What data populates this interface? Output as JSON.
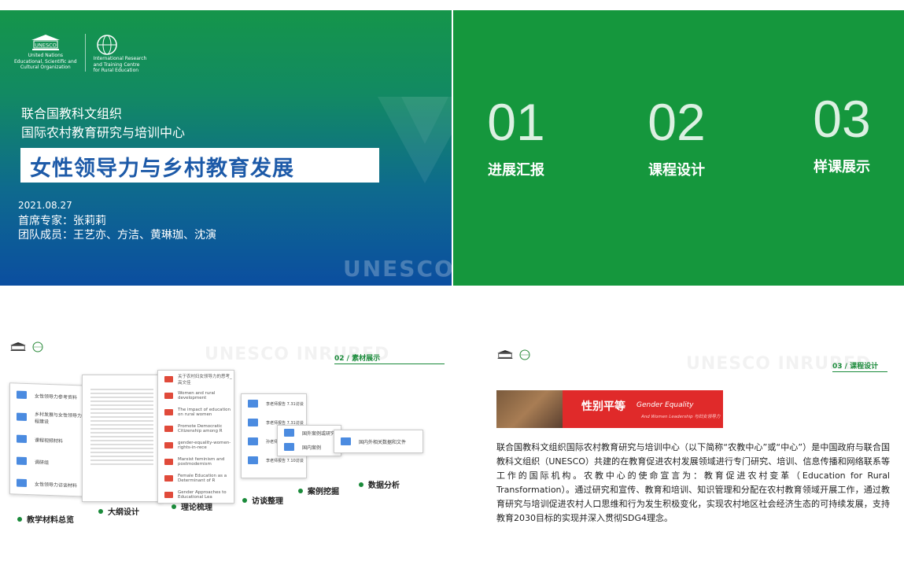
{
  "slide1": {
    "unesco_logo_text": "UNESCO",
    "unesco_caption": [
      "United Nations",
      "Educational, Scientific and",
      "Cultural Organization"
    ],
    "irtc_caption": [
      "International Research",
      "and Training Centre",
      "for Rural Education"
    ],
    "org_line1": "联合国教科文组织",
    "org_line2": "国际农村教育研究与培训中心",
    "title": "女性领导力与乡村教育发展",
    "date": "2021.08.27",
    "lead_expert": "首席专家：张莉莉",
    "team": "团队成员：王艺亦、方洁、黄琳珈、沈演",
    "watermark": "UNESCO"
  },
  "slide2": {
    "sections": [
      {
        "num": "01",
        "label": "进展汇报"
      },
      {
        "num": "02",
        "label": "课程设计"
      },
      {
        "num": "03",
        "label": "样课展示"
      }
    ]
  },
  "slide3": {
    "watermark": "UNESCO INRURED",
    "section_tag": "02 / 素材展示",
    "folder_list": [
      "女性领导力参考资料",
      "乡村发展与女性领导力课程建设",
      "课程视频材料",
      "调研组",
      "女性领导力访谈材料"
    ],
    "pdf_list": [
      "关于农村妇女领导力的思考_高文佳",
      "Women and rural development",
      "The impact of education on rural women",
      "Promote Democratic Citizenship among R",
      "gender-equality-women-rights-in-rece",
      "Marxist feminism and postmodernism",
      "Female Education as a Determinant of R",
      "Gender Approaches to Educational Lea"
    ],
    "media_list": [
      "李老师报告 7.31访谈",
      "李老师报告 7.31访谈",
      "孙老师报告 7.31访谈",
      "李老师报告 7.10访谈"
    ],
    "popup1": [
      "国外案例或研究",
      "国内案例"
    ],
    "popup2": "国内外相关数据和文件",
    "steps": [
      "教学材料总览",
      "大纲设计",
      "理论梳理",
      "访谈整理",
      "案例挖掘",
      "数据分析"
    ]
  },
  "slide4": {
    "watermark": "UNESCO INRURED",
    "section_tag": "03 / 课程设计",
    "banner_title": "性别平等",
    "banner_en": "Gender Equality",
    "banner_sub": "And Women Leadership 与妇女领导力",
    "paragraph": "联合国教科文组织国际农村教育研究与培训中心（以下简称“农教中心”或“中心”）是中国政府与联合国教科文组织（UNESCO）共建的在教育促进农村发展领域进行专门研究、培训、信息传播和网络联系等工作的国际机构。农教中心的使命宣言为：教育促进农村变革（Education for Rural Transformation）。通过研究和宣传、教育和培训、知识管理和分配在农村教育领域开展工作，通过教育研究与培训促进农村人口思维和行为发生积极变化，实现农村地区社会经济生态的可持续发展，支持教育2030目标的实现并深入贯彻SDG4理念。"
  }
}
